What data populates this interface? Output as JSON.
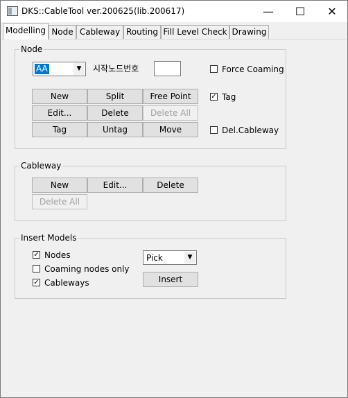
{
  "window": {
    "title": "DKS::CableTool ver.200625(lib.200617)",
    "minimize": "—",
    "maximize": "☐",
    "close": "✕"
  },
  "tabs": [
    {
      "label": "Modelling",
      "active": true
    },
    {
      "label": "Node"
    },
    {
      "label": "Cableway"
    },
    {
      "label": "Routing"
    },
    {
      "label": "Fill Level Check"
    },
    {
      "label": "Drawing"
    }
  ],
  "node_group": {
    "title": "Node",
    "combo_value": "AA",
    "start_node_label": "시작노드번호",
    "start_node_value": "",
    "buttons": {
      "new": "New",
      "split": "Split",
      "free_point": "Free Point",
      "edit": "Edit...",
      "delete": "Delete",
      "delete_all": "Delete All",
      "tag": "Tag",
      "untag": "Untag",
      "move": "Move"
    },
    "force_coaming": {
      "label": "Force Coaming",
      "checked": false
    },
    "tag_check": {
      "label": "Tag",
      "checked": true
    },
    "del_cableway": {
      "label": "Del.Cableway",
      "checked": false
    }
  },
  "cableway_group": {
    "title": "Cableway",
    "buttons": {
      "new": "New",
      "edit": "Edit...",
      "delete": "Delete",
      "delete_all": "Delete All"
    }
  },
  "insert_group": {
    "title": "Insert Models",
    "nodes": {
      "label": "Nodes",
      "checked": true
    },
    "coaming_only": {
      "label": "Coaming nodes only",
      "checked": false
    },
    "cableways": {
      "label": "Cableways",
      "checked": true
    },
    "pick_combo": "Pick",
    "insert_button": "Insert"
  },
  "icons": {
    "check": "✓",
    "dropdown": "▼"
  }
}
